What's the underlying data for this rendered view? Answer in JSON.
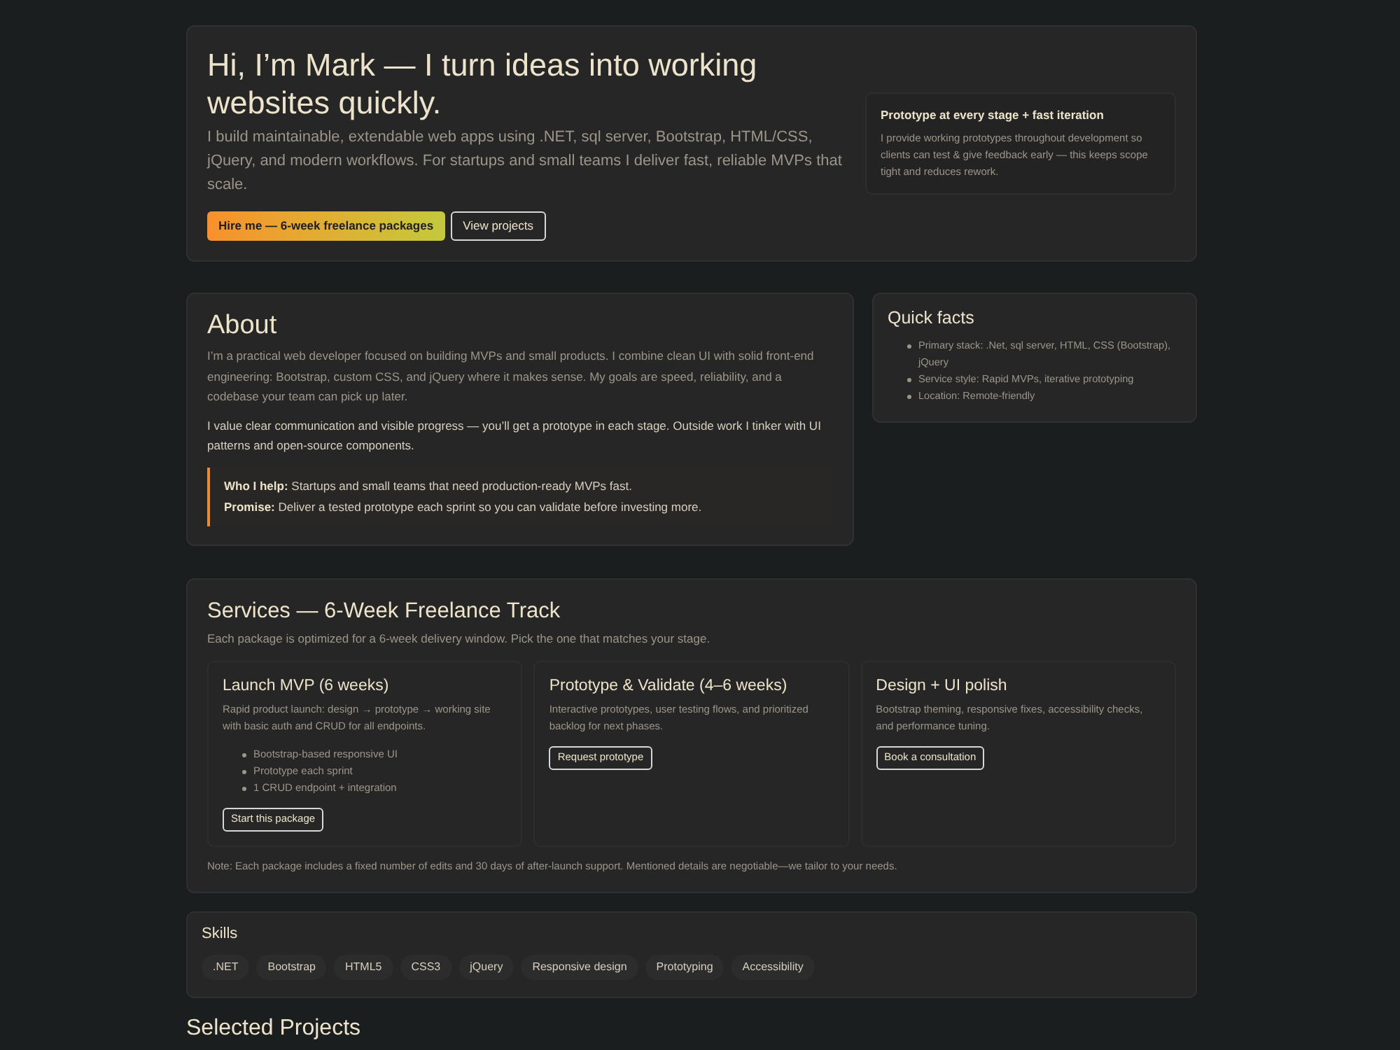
{
  "hero": {
    "title": "Hi, I’m Mark — I turn ideas into working websites quickly.",
    "subtitle": "I build maintainable, extendable web apps using .NET, sql server, Bootstrap, HTML/CSS, jQuery, and modern workflows. For startups and small teams I deliver fast, reliable MVPs that scale.",
    "buttons": [
      {
        "label": "Hire me — 6-week freelance packages",
        "kind": "primary"
      },
      {
        "label": "View projects",
        "kind": "outline"
      }
    ],
    "highlight": {
      "title": "Prototype at every stage + fast iteration",
      "text": "I provide working prototypes throughout development so clients can test & give feedback early — this keeps scope tight and reduces rework."
    }
  },
  "about": {
    "title": "About",
    "paragraphs": [
      {
        "kind": "lead",
        "text": "I’m a practical web developer focused on building MVPs and small products. I combine clean UI with solid front-end engineering: Bootstrap, custom CSS, and jQuery where it makes sense. My goals are speed, reliability, and a codebase your team can pick up later."
      },
      {
        "kind": "body",
        "text": "I value clear communication and visible progress — you’ll get a prototype in each stage. Outside work I tinker with UI patterns and open-source components."
      }
    ],
    "callout": [
      "**Who I help:** Startups and small teams that need production-ready MVPs fast.",
      "**Promise:** Deliver a tested prototype each sprint so you can validate before investing more."
    ]
  },
  "quick_facts": {
    "title": "Quick facts",
    "items": [
      "Primary stack: .Net, sql server, HTML, CSS (Bootstrap), jQuery",
      "Service style: Rapid MVPs, iterative prototyping",
      "Location: Remote-friendly"
    ]
  },
  "services": {
    "title": "Services — 6-Week Freelance Track",
    "subtitle": "Each package is optimized for a 6-week delivery window. Pick the one that matches your stage.",
    "packages": [
      {
        "title": "Launch MVP (6 weeks)",
        "description": "Rapid product launch: design → prototype → working site with basic auth and CRUD for all endpoints.",
        "features": [
          "Bootstrap-based responsive UI",
          "Prototype each sprint",
          "1 CRUD endpoint + integration"
        ],
        "button": "Start this package"
      },
      {
        "title": "Prototype & Validate (4–6 weeks)",
        "description": "Interactive prototypes, user testing flows, and prioritized backlog for next phases.",
        "button": "Request prototype"
      },
      {
        "title": "Design + UI polish",
        "description": "Bootstrap theming, responsive fixes, accessibility checks, and performance tuning.",
        "button": "Book a consultation"
      }
    ],
    "note": "Note: Each package includes a fixed number of edits and 30 days of after-launch support. Mentioned details are negotiable—we tailor to your needs."
  },
  "skills": {
    "title": "Skills",
    "tags": [
      ".NET",
      "Bootstrap",
      "HTML5",
      "CSS3",
      "jQuery",
      "Responsive design",
      "Prototyping",
      "Accessibility"
    ]
  },
  "projects": {
    "title": "Selected Projects"
  }
}
